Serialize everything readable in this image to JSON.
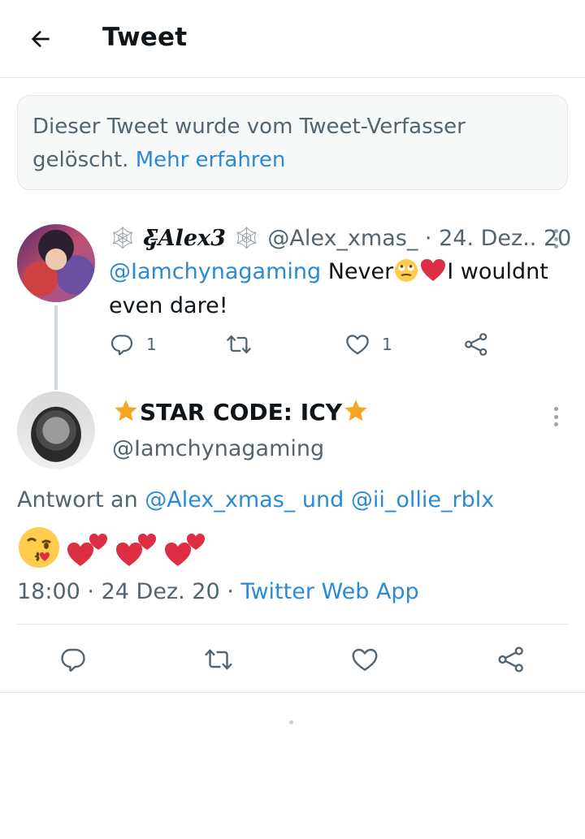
{
  "header": {
    "title": "Tweet"
  },
  "deleted_notice": {
    "text": "Dieser Tweet wurde vom Tweet-Verfasser gelöscht.",
    "link": "Mehr erfahren"
  },
  "tweet1": {
    "display_name": "Ƹ̵̡Alex3",
    "handle": "@Alex_xmas_",
    "separator": "·",
    "date": "24. Dez.. 20",
    "mention": "@Iamchynagaming",
    "text_before": "Never",
    "text_after": "I wouldnt even dare!",
    "reply_count": "1",
    "like_count": "1"
  },
  "tweet2": {
    "display_name": "STAR CODE: ICY",
    "handle": "@Iamchynagaming",
    "reply_prefix": "Antwort an",
    "reply_user1": "@Alex_xmas_",
    "reply_conjunction": "und",
    "reply_user2": "@ii_ollie_rblx",
    "time": "18:00",
    "separator": "·",
    "date": "24 Dez. 20",
    "source": "Twitter Web App"
  },
  "colors": {
    "link": "#2b8ad6",
    "text": "#0f1419",
    "secondary": "#536471",
    "heart": "#e0245e",
    "star": "#f4a623"
  },
  "icons": [
    "arrow-left-icon",
    "more-vertical-icon",
    "reply-icon",
    "retweet-icon",
    "like-icon",
    "share-icon",
    "star-icon",
    "spider-web-icon"
  ]
}
